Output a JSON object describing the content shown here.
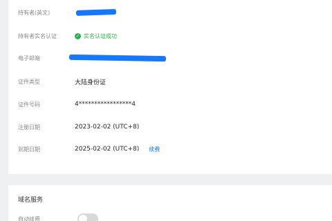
{
  "info": {
    "holder_name": {
      "label": "持有者(英文)",
      "value_redacted": true
    },
    "real_name": {
      "label": "持有者实名认证",
      "status": "实名认证成功",
      "status_icon": "check-circle-icon",
      "status_color": "#2bb24c"
    },
    "email": {
      "label": "电子邮箱",
      "value_redacted": true
    },
    "id_type": {
      "label": "证件类型",
      "value": "大陆身份证"
    },
    "id_number": {
      "label": "证件号码",
      "value": "4*****************4"
    },
    "reg_date": {
      "label": "注册日期",
      "value": "2023-02-02 (UTC+8)"
    },
    "exp_date": {
      "label": "到期日期",
      "value": "2025-02-02 (UTC+8)",
      "action": "续费"
    }
  },
  "service": {
    "title": "域名服务",
    "auto_renew": {
      "label": "自动续费",
      "enabled": false
    }
  },
  "colors": {
    "accent": "#1677ff",
    "redaction": "#1677ff"
  }
}
